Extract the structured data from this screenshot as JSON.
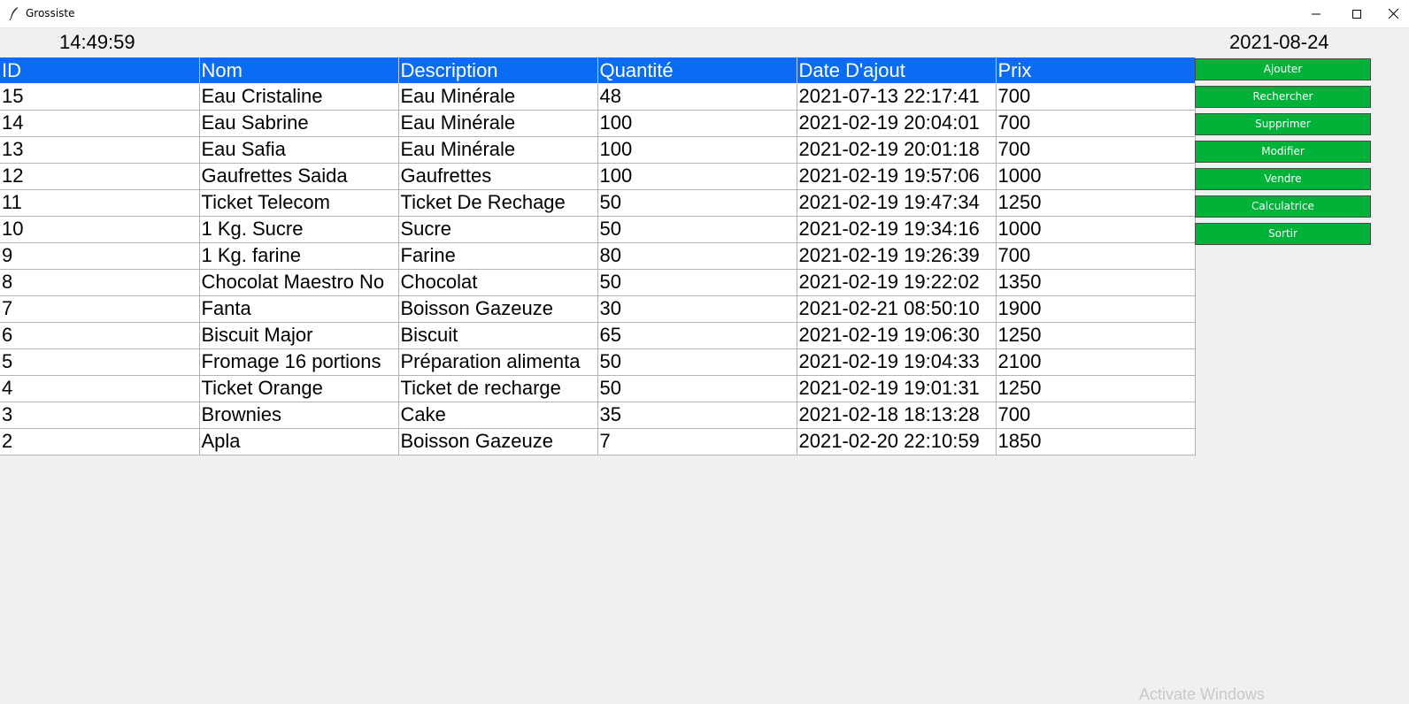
{
  "window": {
    "title": "Grossiste",
    "controls": {
      "minimize": "minimize-icon",
      "maximize": "maximize-icon",
      "close": "close-icon"
    }
  },
  "header": {
    "time": "14:49:59",
    "date": "2021-08-24"
  },
  "table": {
    "columns": [
      "ID",
      "Nom",
      "Description",
      "Quantité",
      "Date D'ajout",
      "Prix"
    ],
    "rows": [
      [
        "15",
        "Eau Cristaline",
        "Eau Minérale",
        "48",
        "2021-07-13 22:17:41",
        "700"
      ],
      [
        "14",
        "Eau Sabrine",
        "Eau Minérale",
        "100",
        "2021-02-19 20:04:01",
        "700"
      ],
      [
        "13",
        "Eau Safia",
        "Eau Minérale",
        "100",
        "2021-02-19 20:01:18",
        "700"
      ],
      [
        "12",
        "Gaufrettes Saida",
        "Gaufrettes",
        "100",
        "2021-02-19 19:57:06",
        "1000"
      ],
      [
        "11",
        "Ticket Telecom",
        "Ticket De Rechage",
        "50",
        "2021-02-19 19:47:34",
        "1250"
      ],
      [
        "10",
        "1 Kg. Sucre",
        "Sucre",
        "50",
        "2021-02-19 19:34:16",
        "1000"
      ],
      [
        "9",
        "1 Kg. farine",
        "Farine",
        "80",
        "2021-02-19 19:26:39",
        "700"
      ],
      [
        "8",
        "Chocolat Maestro No",
        "Chocolat",
        "50",
        "2021-02-19 19:22:02",
        "1350"
      ],
      [
        "7",
        "Fanta",
        "Boisson Gazeuze",
        "30",
        "2021-02-21 08:50:10",
        "1900"
      ],
      [
        "6",
        "Biscuit Major",
        "Biscuit",
        "65",
        "2021-02-19 19:06:30",
        "1250"
      ],
      [
        "5",
        "Fromage 16 portions",
        "Préparation alimenta",
        "50",
        "2021-02-19 19:04:33",
        "2100"
      ],
      [
        "4",
        "Ticket Orange",
        "Ticket de recharge",
        "50",
        "2021-02-19 19:01:31",
        "1250"
      ],
      [
        "3",
        "Brownies",
        "Cake",
        "35",
        "2021-02-18 18:13:28",
        "700"
      ],
      [
        "2",
        "Apla",
        "Boisson Gazeuze",
        "7",
        "2021-02-20 22:10:59",
        "1850"
      ]
    ]
  },
  "buttons": [
    "Ajouter",
    "Rechercher",
    "Supprimer",
    "Modifier",
    "Vendre",
    "Calculatrice",
    "Sortir"
  ],
  "watermark": "Activate Windows",
  "colors": {
    "header_bg": "#0a6cf5",
    "button_bg": "#00b238",
    "window_bg": "#f0f0f0"
  }
}
